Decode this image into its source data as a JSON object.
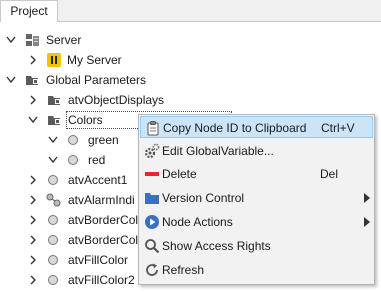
{
  "tab": {
    "label": "Project"
  },
  "tree": {
    "server": "Server",
    "my_server": "My Server",
    "global_parameters": "Global Parameters",
    "atv_object_displays": "atvObjectDisplays",
    "colors": "Colors",
    "green": "green",
    "red": "red",
    "atv_accent1": "atvAccent1",
    "atv_alarm_indi": "atvAlarmIndi",
    "atv_border_col_1": "atvBorderCol",
    "atv_border_col_2": "atvBorderCol",
    "atv_fill_color": "atvFillColor",
    "atv_fill_color2": "atvFillColor2"
  },
  "context_menu": {
    "copy_node_id": {
      "label": "Copy Node ID to Clipboard",
      "shortcut": "Ctrl+V"
    },
    "edit_global_variable": {
      "label": "Edit GlobalVariable..."
    },
    "delete": {
      "label": "Delete",
      "shortcut": "Del"
    },
    "version_control": {
      "label": "Version Control"
    },
    "node_actions": {
      "label": "Node Actions"
    },
    "show_access_rights": {
      "label": "Show Access Rights"
    },
    "refresh": {
      "label": "Refresh"
    }
  },
  "colors": {
    "selection": "#cce4f7",
    "delete_red": "#e8252a",
    "action_blue": "#3a6fc4",
    "folder_gray": "#5a5a5a"
  }
}
